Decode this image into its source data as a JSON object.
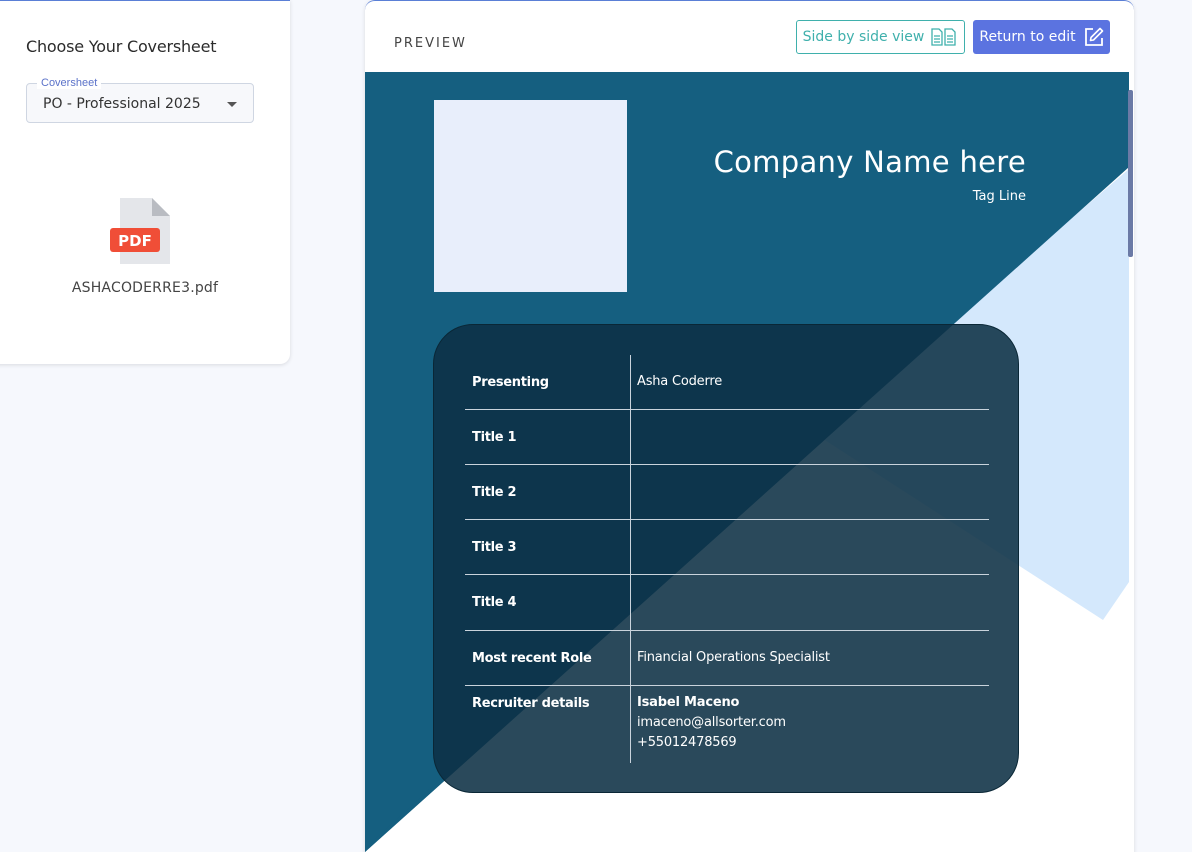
{
  "sidebar": {
    "title": "Choose Your Coversheet",
    "select": {
      "legend": "Coversheet",
      "value": "PO - Professional 2025"
    },
    "file": {
      "icon": "pdf-file-icon",
      "badge": "PDF",
      "name": "ASHACODERRE3.pdf"
    }
  },
  "preview": {
    "label": "PREVIEW",
    "side_by_side_label": "Side by side view",
    "return_label": "Return to edit"
  },
  "document": {
    "company_name": "Company Name here",
    "tag_line": "Tag Line",
    "rows": [
      {
        "label": "Presenting",
        "value": "Asha Coderre"
      },
      {
        "label": "Title 1",
        "value": ""
      },
      {
        "label": "Title 2",
        "value": ""
      },
      {
        "label": "Title 3",
        "value": ""
      },
      {
        "label": "Title 4",
        "value": ""
      },
      {
        "label": "Most recent Role",
        "value": "Financial Operations Specialist"
      },
      {
        "label": "Recruiter details",
        "value": "Isabel Maceno",
        "email": "imaceno@allsorter.com",
        "phone": "+55012478569"
      }
    ]
  },
  "colors": {
    "accent": "#5b73e0",
    "teal": "#3fb0ac",
    "doc_dark": "#155f80",
    "doc_light": "#d4e8fc",
    "card": "#0c3044",
    "pdf_red": "#f04e37"
  }
}
